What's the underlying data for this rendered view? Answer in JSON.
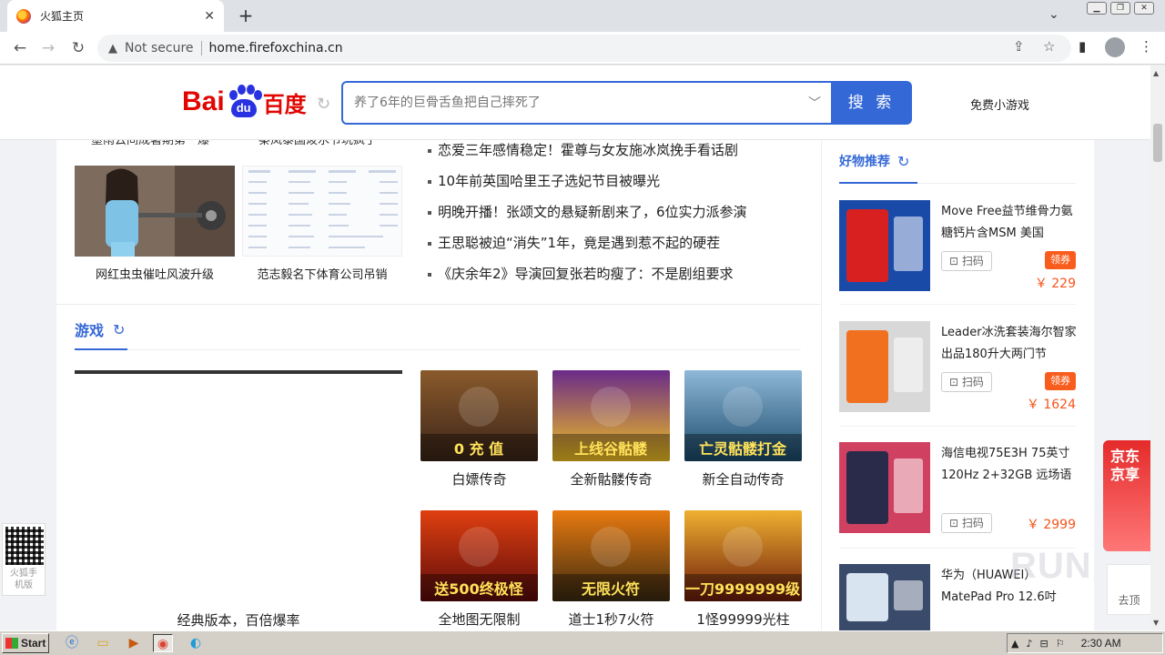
{
  "browser": {
    "tab_title": "火狐主页",
    "tab_close": "✕",
    "new_tab": "+",
    "security_label": "Not secure",
    "url": "home.firefoxchina.cn"
  },
  "header": {
    "logo_bai": "Bai",
    "logo_du": "du",
    "logo_cn": "百度",
    "search_placeholder": "养了6年的巨骨舌鱼把自己摔死了",
    "search_button": "搜 索",
    "free_games": "免费小游戏"
  },
  "news": {
    "cut_captions": [
      "墨雨云间成暑期第一爆",
      "秦岚泰国泼水节玩疯了"
    ],
    "thumbs": [
      {
        "caption": "网红虫虫催吐风波升级"
      },
      {
        "caption": "范志毅名下体育公司吊销"
      }
    ],
    "headlines": [
      "恋爱三年感情稳定！霍尊与女友施冰岚挽手看话剧",
      "10年前英国哈里王子选妃节目被曝光",
      "明晚开播！张颂文的悬疑新剧来了，6位实力派参演",
      "王思聪被迫“消失”1年，竟是遇到惹不起的硬茬",
      "《庆余年2》导演回复张若昀瘦了：不是剧组要求"
    ]
  },
  "games": {
    "title": "游戏",
    "big_caption": "经典版本，百倍爆率",
    "tiles": [
      {
        "caption": "白嫖传奇",
        "art": "0 充 值",
        "colors": [
          "#3a2418",
          "#8a5a2c"
        ]
      },
      {
        "caption": "全新骷髅传奇",
        "art": "上线谷骷髅",
        "colors": [
          "#f0c020",
          "#6a2a8a"
        ]
      },
      {
        "caption": "新全自动传奇",
        "art": "亡灵骷髅打金",
        "colors": [
          "#1a4a6a",
          "#8fb8d8"
        ]
      },
      {
        "caption": "全地图无限制",
        "art": "送500终极怪",
        "colors": [
          "#5a0a0a",
          "#e04010"
        ]
      },
      {
        "caption": "道士1秒7火符",
        "art": "无限火符",
        "colors": [
          "#3a2a10",
          "#e87a10"
        ]
      },
      {
        "caption": "1怪99999光柱",
        "art": "一刀9999999级",
        "colors": [
          "#6a1a0a",
          "#f0b030"
        ]
      }
    ]
  },
  "sidebar": {
    "title": "好物推荐",
    "scan_label": "扫码",
    "products": [
      {
        "name": "Move Free益节维骨力氨糖钙片含MSM 美国",
        "coupon": "领券",
        "price": "￥ 229",
        "colors": [
          "#d82020",
          "#1a4aa8"
        ]
      },
      {
        "name": "Leader冰洗套装海尔智家出品180升大两门节",
        "coupon": "领券",
        "price": "￥ 1624",
        "colors": [
          "#f07020",
          "#d8d8d8"
        ]
      },
      {
        "name": "海信电视75E3H 75英寸 120Hz 2+32GB 远场语",
        "coupon": "",
        "price": "￥ 2999",
        "colors": [
          "#2a2a4a",
          "#d04060"
        ]
      },
      {
        "name": "华为（HUAWEI）MatePad Pro 12.6吋",
        "coupon": "",
        "price": "",
        "colors": [
          "#d8e4f0",
          "#3a4a6a"
        ]
      }
    ]
  },
  "floating": {
    "qr_caption_1": "火狐手",
    "qr_caption_2": "机版",
    "jd_text": "京东京享",
    "back_label": "去顶",
    "watermark": "RUN"
  },
  "taskbar": {
    "start_label": "Start",
    "time": "2:30 AM"
  }
}
